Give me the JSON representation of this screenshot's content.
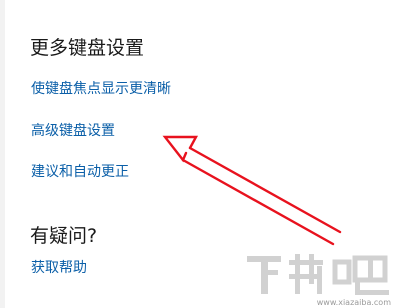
{
  "sections": {
    "more_keyboard_settings": {
      "title": "更多键盘设置",
      "links": [
        {
          "label": "使键盘焦点显示更清晰"
        },
        {
          "label": "高级键盘设置"
        },
        {
          "label": "建议和自动更正"
        }
      ]
    },
    "have_question": {
      "title": "有疑问?",
      "links": [
        {
          "label": "获取帮助"
        }
      ]
    }
  },
  "annotation": {
    "arrow_color": "#e8121e"
  },
  "watermark": {
    "text": "下载吧",
    "url": "www.xiazaiba.com"
  }
}
